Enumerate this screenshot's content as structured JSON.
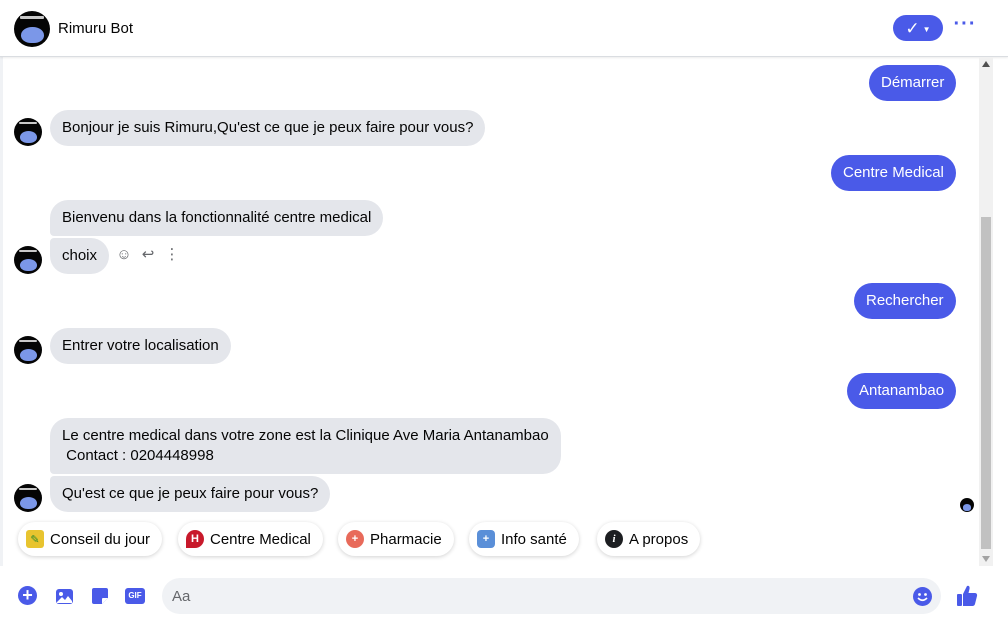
{
  "header": {
    "title": "Rimuru Bot",
    "status_icon": "check-icon",
    "more_icon": "more-dots-icon"
  },
  "messages": [
    {
      "from": "user",
      "text": "Démarrer"
    },
    {
      "from": "bot",
      "text": "Bonjour je suis Rimuru,Qu'est ce que je peux faire pour vous?"
    },
    {
      "from": "user",
      "text": "Centre Medical"
    },
    {
      "from": "bot",
      "text": "Bienvenu dans la fonctionnalité centre medical"
    },
    {
      "from": "bot",
      "text": "choix"
    },
    {
      "from": "user",
      "text": "Rechercher"
    },
    {
      "from": "bot",
      "text": "Entrer votre localisation"
    },
    {
      "from": "user",
      "text": "Antanambao"
    },
    {
      "from": "bot",
      "text": "Le centre medical dans votre zone est la Clinique Ave Maria Antanambao\n Contact : 0204448998"
    },
    {
      "from": "bot",
      "text": "Qu'est ce que je peux faire pour vous?"
    }
  ],
  "message_actions": [
    "react-icon",
    "reply-icon",
    "more-vertical-icon"
  ],
  "quick_replies": [
    {
      "label": "Conseil du jour",
      "icon": "bulb-icon"
    },
    {
      "label": "Centre Medical",
      "icon": "hospital-pin-icon"
    },
    {
      "label": "Pharmacie",
      "icon": "pharmacy-icon"
    },
    {
      "label": "Info santé",
      "icon": "health-info-icon"
    },
    {
      "label": "A propos",
      "icon": "info-icon"
    }
  ],
  "composer": {
    "placeholder": "Aa",
    "gif_label": "GIF"
  },
  "colors": {
    "accent": "#4a5ae8",
    "incoming_bubble": "#e4e6eb",
    "outgoing_text": "#ffffff"
  }
}
